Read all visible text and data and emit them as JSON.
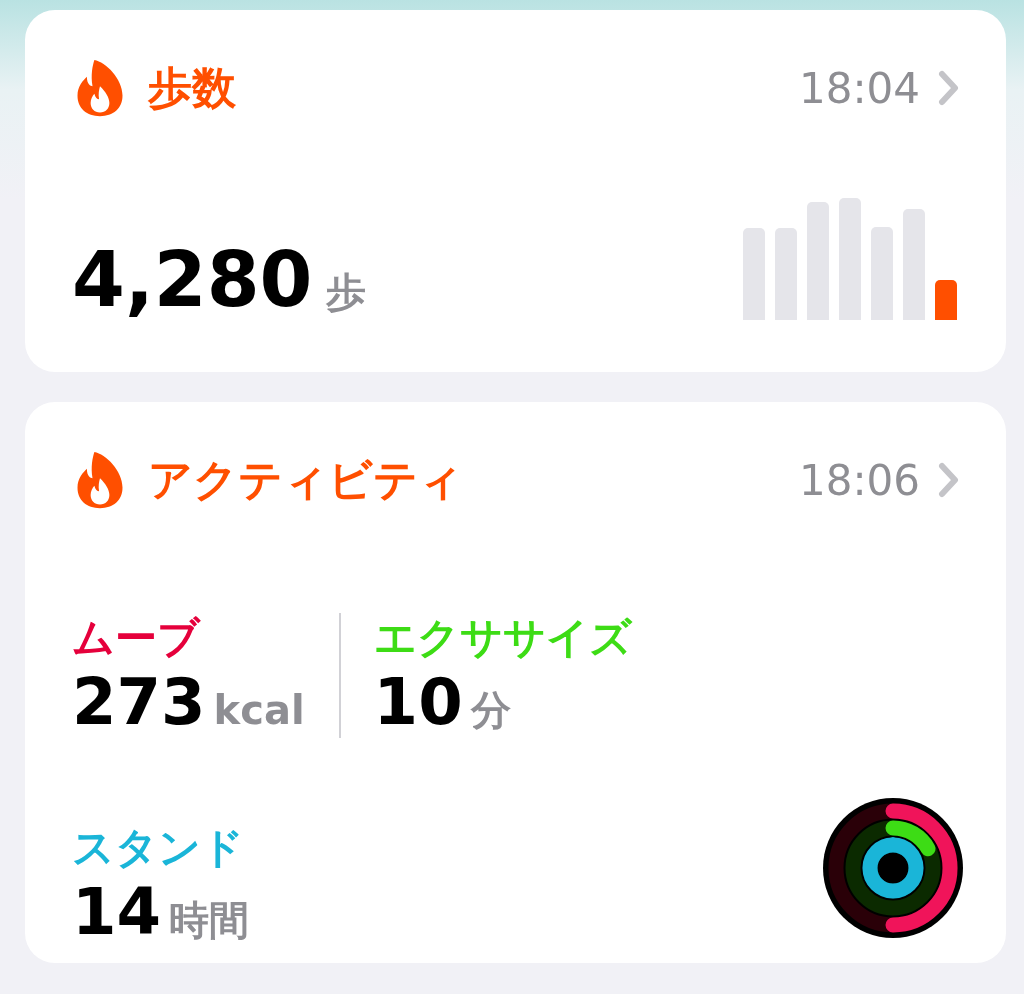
{
  "cards": [
    {
      "kind": "steps",
      "title": "歩数",
      "time": "18:04",
      "value": "4,280",
      "unit": "歩"
    },
    {
      "kind": "activity",
      "title": "アクティビティ",
      "time": "18:06",
      "metrics": [
        {
          "label": "ムーブ",
          "value": "273",
          "unit": "kcal",
          "color": "#e5003b",
          "level": 0.5
        },
        {
          "label": "エクササイズ",
          "value": "10",
          "unit": "分",
          "color": "#3ddc15",
          "level": 0.17
        },
        {
          "label": "スタンド",
          "value": "14",
          "unit": "時間",
          "color": "#1ab5d8",
          "level": 1
        }
      ]
    }
  ]
}
